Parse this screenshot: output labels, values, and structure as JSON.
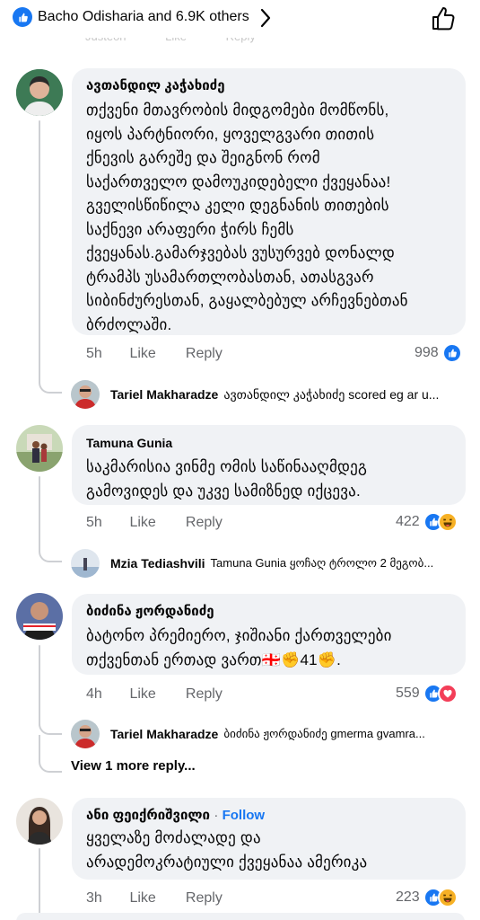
{
  "header": {
    "reactors": "Bacho Odisharia and 6.9K others"
  },
  "ghost_actions": {
    "time": "Justeon",
    "like": "Like",
    "reply": "Reply"
  },
  "comments": [
    {
      "author": "ავთანდილ კაჭახიძე",
      "lines": [
        "თქვენი მთავრობის მიდგომები მომწონს,",
        "იყოს პარტნიორი, ყოველგვარი თითის",
        "ქნევის გარეშე და შეიგნონ რომ",
        "საქართველო დამოუკიდებელი ქვეყანაა!",
        "გველისწიწილა კელი დეგნანის თითების",
        "საქნევი არაფერი ჭირს ჩემს",
        "ქვეყანას.გამარჯვებას ვუსურვებ დონალდ",
        "ტრამპს უსამართლობასთან, ათასგვარ",
        "სიბინძურესთან, გაყალბებულ არჩევნებთან",
        "ბრძოლაში."
      ],
      "time": "5h",
      "like": "Like",
      "reply": "Reply",
      "reaction_count": "998",
      "reactions": [
        "like"
      ],
      "reply_preview": {
        "name": "Tariel Makharadze",
        "text": "ავთანდილ კაჭახიძე scored eg ar u..."
      }
    },
    {
      "author": "Tamuna Gunia",
      "lines": [
        "საკმარისია ვინმე ომის საწინააღმდეგ",
        "გამოვიდეს და უკვე სამიზნედ იქცევა."
      ],
      "time": "5h",
      "like": "Like",
      "reply": "Reply",
      "reaction_count": "422",
      "reactions": [
        "like",
        "haha"
      ],
      "reply_preview": {
        "name": "Mzia Tediashvili",
        "text": "Tamuna Gunia ყოჩაღ ტროლო 2 მეგობ..."
      }
    },
    {
      "author": "ბიძინა ჟორდანიძე",
      "lines": [
        "ბატონო პრემიერო, ჯიშიანი ქართველები",
        "თქვენთან ერთად ვართ🇬🇪✊41✊."
      ],
      "time": "4h",
      "like": "Like",
      "reply": "Reply",
      "reaction_count": "559",
      "reactions": [
        "like",
        "love"
      ],
      "reply_preview": {
        "name": "Tariel Makharadze",
        "text": "ბიძინა ჟორდანიძე gmerma gvamra..."
      },
      "view_more": "View 1 more reply..."
    },
    {
      "author": "ანი ფეიქრიშვილი",
      "follow": "Follow",
      "lines": [
        "ყველაზე  მოძალადე  და",
        "არადემოკრატიული ქვეყანაა ამერიკა"
      ],
      "time": "3h",
      "like": "Like",
      "reply": "Reply",
      "reaction_count": "223",
      "reactions": [
        "like",
        "haha"
      ]
    }
  ],
  "colors": {
    "accent": "#1877f2",
    "bubble": "#f0f2f5",
    "muted": "#65676b",
    "love": "#f33e58",
    "haha": "#f7b125"
  }
}
